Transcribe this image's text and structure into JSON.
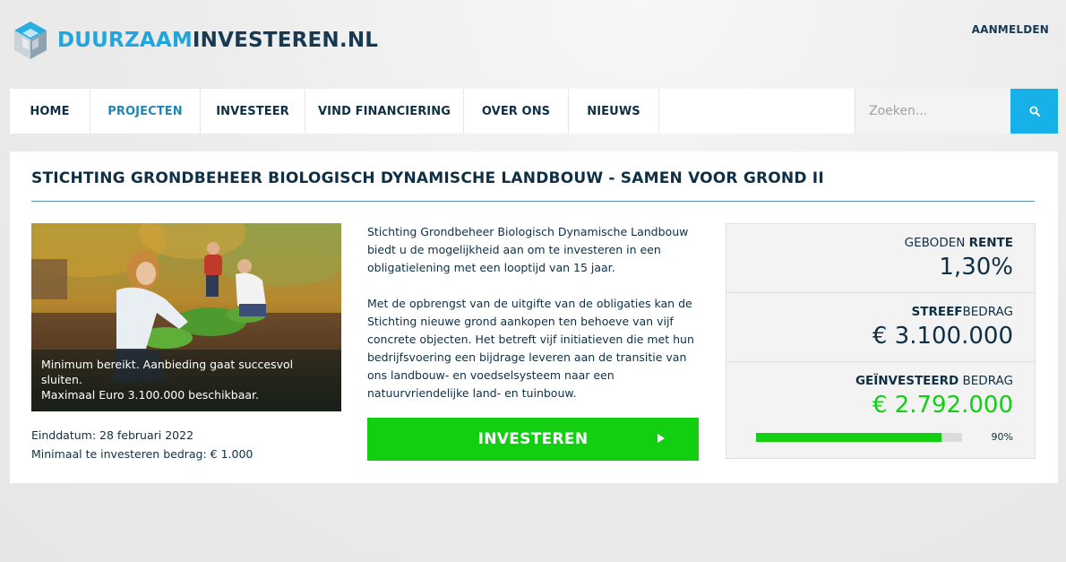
{
  "header": {
    "logo_part1": "DUURZAAM",
    "logo_part2": "INVESTEREN.NL",
    "login_label": "AANMELDEN"
  },
  "nav": {
    "items": [
      {
        "label": "HOME"
      },
      {
        "label": "PROJECTEN",
        "active": true
      },
      {
        "label": "INVESTEER"
      },
      {
        "label": "VIND FINANCIERING"
      },
      {
        "label": "OVER ONS"
      },
      {
        "label": "NIEUWS"
      }
    ],
    "search_placeholder": "Zoeken..."
  },
  "project": {
    "title": "STICHTING GRONDBEHEER BIOLOGISCH DYNAMISCHE LANDBOUW - SAMEN VOOR GROND II",
    "image_caption_line1": "Minimum bereikt. Aanbieding gaat succesvol sluiten.",
    "image_caption_line2": "Maximaal Euro 3.100.000 beschikbaar.",
    "end_date": "Einddatum: 28 februari 2022",
    "min_amount": "Minimaal te investeren bedrag: € 1.000",
    "description_p1": "Stichting Grondbeheer Biologisch Dynamische Landbouw biedt u de mogelijkheid aan om te investeren in een obligatielening met een looptijd van 15 jaar.",
    "description_p2": "Met de opbrengst van de uitgifte van de obligaties kan de Stichting nieuwe grond aankopen ten behoeve van vijf concrete objecten. Het betreft vijf initiatieven die met hun bedrijfsvoering een bijdrage leveren aan de transitie van ons landbouw- en voedselsysteem naar een natuurvriendelijke land- en tuinbouw.",
    "invest_button": "INVESTEREN"
  },
  "stats": {
    "rate_label_plain": "GEBODEN ",
    "rate_label_bold": "RENTE",
    "rate_value": "1,30%",
    "target_label_bold": "STREEF",
    "target_label_plain": "BEDRAG",
    "target_value": "€ 3.100.000",
    "invested_label_bold": "GEÏNVESTEERD",
    "invested_label_plain": " BEDRAG",
    "invested_value": "€ 2.792.000",
    "progress_fraction": 0.9,
    "progress_label": "90%"
  },
  "colors": {
    "accent_blue": "#15b1e8",
    "invest_green": "#12cf12",
    "navy": "#0e2f44"
  }
}
